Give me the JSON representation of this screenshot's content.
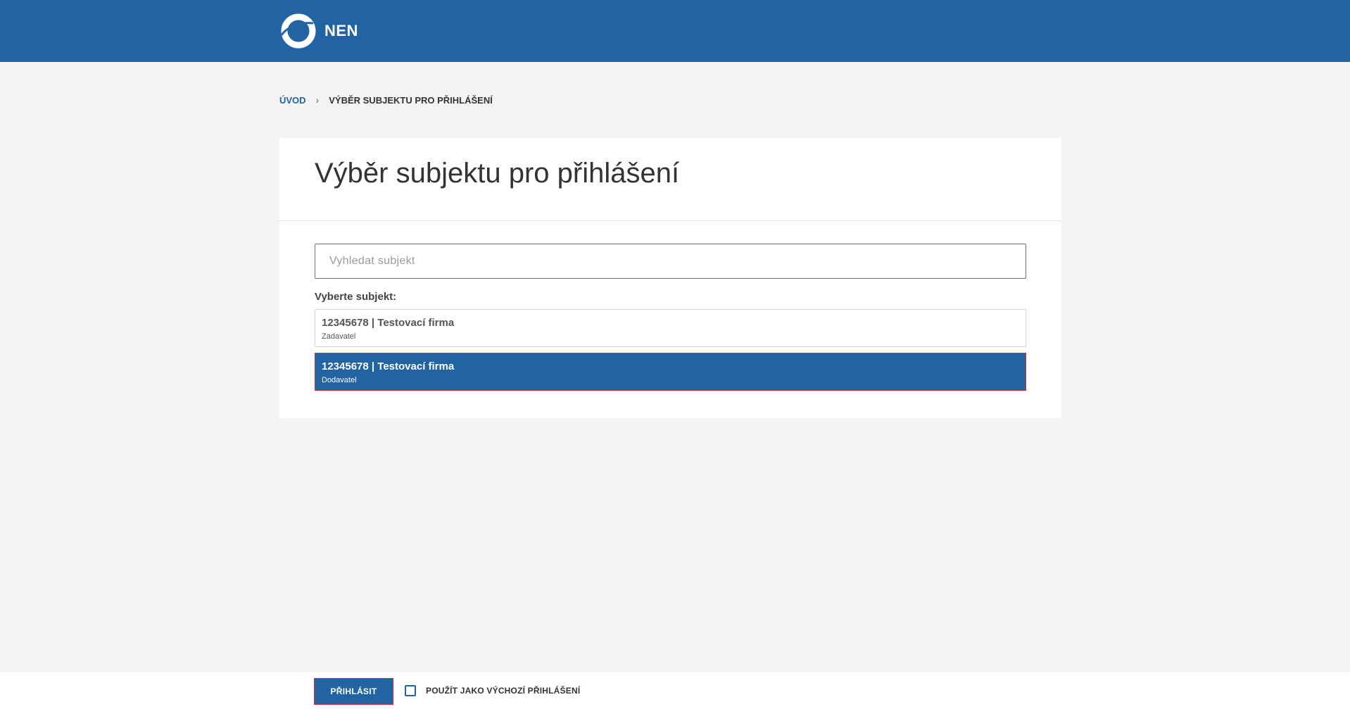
{
  "header": {
    "logo_text": "NEN",
    "background": "#2263a4",
    "logo_icon": "nen-ring-logo-icon"
  },
  "breadcrumb": {
    "home": "ÚVOD",
    "separator": "›",
    "current": "VÝBĚR SUBJEKTU PRO PŘIHLÁŠENÍ"
  },
  "card": {
    "title": "Výběr subjektu pro přihlášení",
    "search_placeholder": "Vyhledat subjekt",
    "search_value": "",
    "list_label": "Vyberte subjekt:",
    "subjects": [
      {
        "name": "12345678 | Testovací firma",
        "role": "Zadavatel",
        "selected": false
      },
      {
        "name": "12345678 | Testovací firma",
        "role": "Dodavatel",
        "selected": true
      }
    ]
  },
  "footer": {
    "login_button": "PŘIHLÁSIT",
    "default_login_label": "POUŽÍT JAKO VÝCHOZÍ PŘIHLÁŠENÍ",
    "default_login_checked": false
  },
  "colors": {
    "brand": "#2263a4",
    "page_background": "#f4f4f4",
    "focus_outline": "#d12f3a"
  }
}
